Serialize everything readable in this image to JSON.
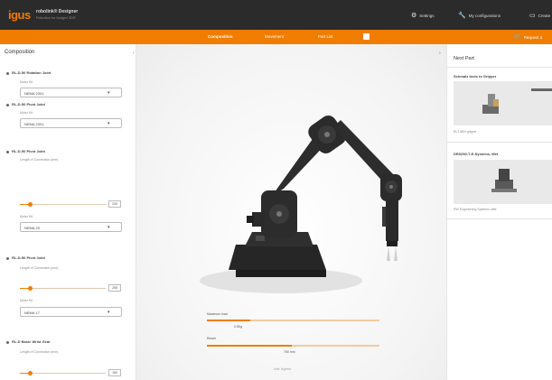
{
  "app": {
    "logo": "igus",
    "brand_line1": "robolink® Designer",
    "brand_line2": "Robotics for budget 3D®"
  },
  "top_links": [
    {
      "icon": "gear-icon",
      "label": "Settings"
    },
    {
      "icon": "wrench-icon",
      "label": "My configurations"
    },
    {
      "icon": "monitor-icon",
      "label": "Create"
    }
  ],
  "nav": {
    "tabs": [
      "Composition",
      "Movement",
      "Part List"
    ],
    "active_tab": "Composition",
    "request_label": "Request a"
  },
  "composition": {
    "title": "Composition",
    "joints": [
      {
        "title": "RL-D-50 Rotation Joint",
        "sub_label": "Motor Kit",
        "select": "NEMA 23XL"
      },
      {
        "title": "RL-D-50 Pivot Joint",
        "sub_label": "Motor Kit",
        "select": "NEMA 23XL"
      },
      {
        "title": "RL-D-50 Pivot Joint",
        "sub_label": "Length of Connection (mm)",
        "slider_value": "230",
        "slider_fraction": 0.1,
        "sub_label2": "Motor Kit",
        "select": "NEMA 23"
      },
      {
        "title": "RL-D-50 Pivot Joint",
        "sub_label": "Length of Connection (mm)",
        "slider_value": "255",
        "slider_fraction": 0.1,
        "sub_label2": "Motor Kit",
        "select": "NEMA 17"
      },
      {
        "title": "RL-D Basic Wrist Gear",
        "sub_label": "Length of Connection (mm)",
        "slider_value": "150",
        "slider_fraction": 0.1
      }
    ]
  },
  "viewport_bars": [
    {
      "label": "Maximum load",
      "value": "0.5Kg",
      "fraction": 0.25
    },
    {
      "label": "Reach",
      "value": "760 mm",
      "fraction": 0.49
    }
  ],
  "viewport_unit": "Unit: Kg/mm",
  "next_part": {
    "title": "Next Part",
    "items": [
      {
        "name": "Schmalz tools to Gripper",
        "caption": "RLT-MIN gripper"
      },
      {
        "name": "DR0250-T-E-Systems, Met",
        "caption": "RW Engineering Systems offer"
      }
    ]
  },
  "colors": {
    "accent": "#f07d00",
    "topbar": "#2b2b2b",
    "robot_body": "#2d2d2d"
  }
}
